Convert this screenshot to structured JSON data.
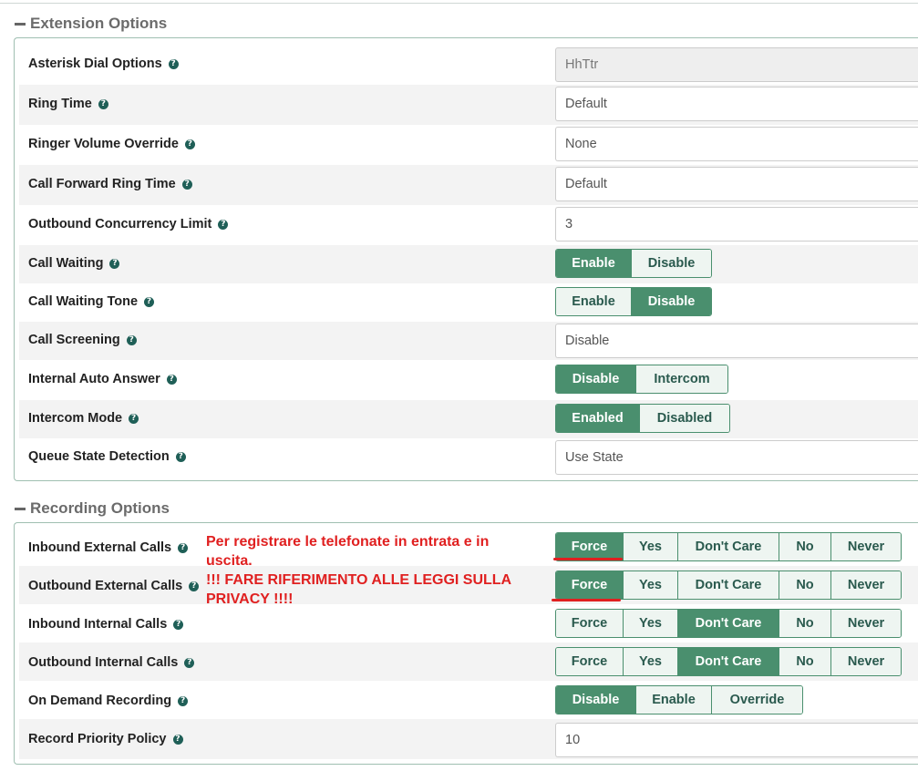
{
  "extension": {
    "title": "Extension Options",
    "dial_options": {
      "label": "Asterisk Dial Options",
      "value": "HhTtr"
    },
    "ring_time": {
      "label": "Ring Time",
      "value": "Default"
    },
    "ringer_volume": {
      "label": "Ringer Volume Override",
      "value": "None"
    },
    "cf_ring_time": {
      "label": "Call Forward Ring Time",
      "value": "Default"
    },
    "outbound_limit": {
      "label": "Outbound Concurrency Limit",
      "value": "3"
    },
    "call_waiting": {
      "label": "Call Waiting",
      "options": [
        "Enable",
        "Disable"
      ],
      "selected": "Enable"
    },
    "call_waiting_tone": {
      "label": "Call Waiting Tone",
      "options": [
        "Enable",
        "Disable"
      ],
      "selected": "Disable"
    },
    "call_screening": {
      "label": "Call Screening",
      "value": "Disable"
    },
    "auto_answer": {
      "label": "Internal Auto Answer",
      "options": [
        "Disable",
        "Intercom"
      ],
      "selected": "Disable"
    },
    "intercom_mode": {
      "label": "Intercom Mode",
      "options": [
        "Enabled",
        "Disabled"
      ],
      "selected": "Enabled"
    },
    "queue_state": {
      "label": "Queue State Detection",
      "value": "Use State"
    }
  },
  "recording": {
    "title": "Recording Options",
    "inbound_external": {
      "label": "Inbound External Calls",
      "options": [
        "Force",
        "Yes",
        "Don't Care",
        "No",
        "Never"
      ],
      "selected": "Force"
    },
    "outbound_external": {
      "label": "Outbound External Calls",
      "options": [
        "Force",
        "Yes",
        "Don't Care",
        "No",
        "Never"
      ],
      "selected": "Force"
    },
    "inbound_internal": {
      "label": "Inbound Internal Calls",
      "options": [
        "Force",
        "Yes",
        "Don't Care",
        "No",
        "Never"
      ],
      "selected": "Don't Care"
    },
    "outbound_internal": {
      "label": "Outbound Internal Calls",
      "options": [
        "Force",
        "Yes",
        "Don't Care",
        "No",
        "Never"
      ],
      "selected": "Don't Care"
    },
    "on_demand": {
      "label": "On Demand Recording",
      "options": [
        "Disable",
        "Enable",
        "Override"
      ],
      "selected": "Disable"
    },
    "priority": {
      "label": "Record Priority Policy",
      "value": "10"
    }
  },
  "annotation": {
    "line1": "Per registrare le telefonate in entrata e in",
    "line2": "uscita.",
    "line3": "!!! FARE RIFERIMENTO ALLE LEGGI SULLA",
    "line4": "PRIVACY !!!!",
    "color": "#e02020"
  },
  "colors": {
    "accent": "#4a8f6e",
    "help_icon": "#1f5f57",
    "border": "#9fbfb1"
  },
  "icons": {
    "help": "question-circle-icon",
    "collapse": "minus-icon"
  }
}
